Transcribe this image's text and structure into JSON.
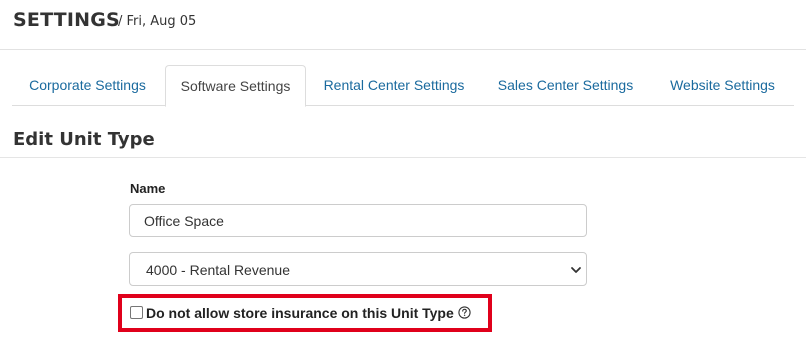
{
  "header": {
    "title": "SETTINGS",
    "subtitle": "/ Fri, Aug 05"
  },
  "tabs": [
    {
      "label": "Corporate Settings",
      "active": false
    },
    {
      "label": "Software Settings",
      "active": true
    },
    {
      "label": "Rental Center Settings",
      "active": false
    },
    {
      "label": "Sales Center Settings",
      "active": false
    },
    {
      "label": "Website Settings",
      "active": false
    }
  ],
  "form": {
    "title": "Edit Unit Type",
    "name_label": "Name",
    "name_value": "Office Space",
    "account_select_value": "4000 - Rental Revenue",
    "insurance_checkbox_label": "Do not allow store insurance on this Unit Type",
    "insurance_checkbox_checked": false
  },
  "colors": {
    "link": "#1a6a9e",
    "highlight": "#e0001b"
  },
  "icons": {
    "help": "help-circle-icon",
    "dropdown": "chevron-down-icon"
  }
}
